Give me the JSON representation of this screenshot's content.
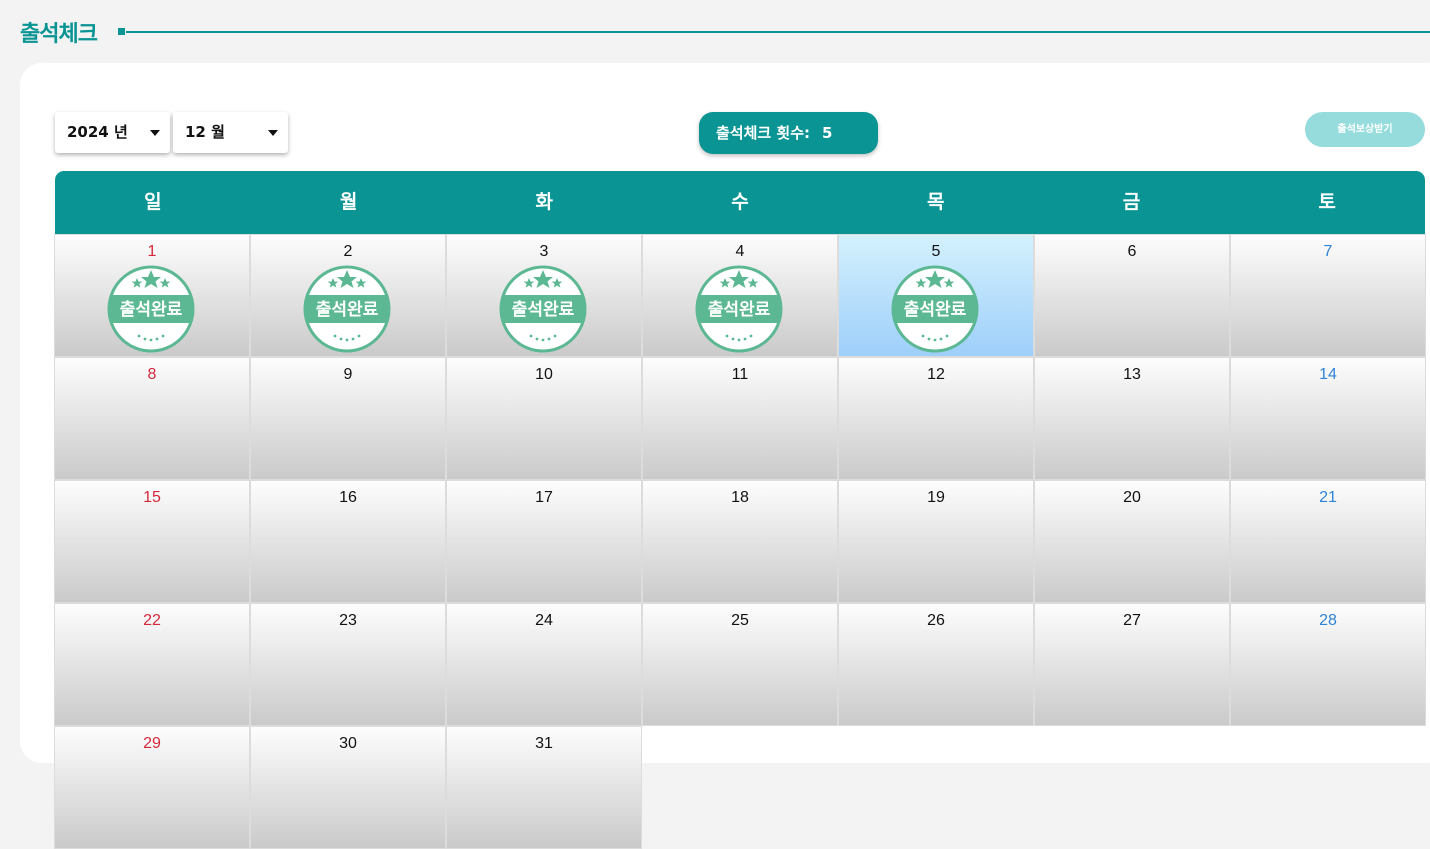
{
  "header": {
    "title": "출석체크"
  },
  "controls": {
    "year_label": "2024 년",
    "month_label": "12 월",
    "count_label": "출석체크 횟수:",
    "count_value": "5",
    "reward_button": "출석보상받기"
  },
  "stamp": {
    "text": "출석완료",
    "color": "#5cb893",
    "inner_band": "#5cb893"
  },
  "colors": {
    "accent": "#0a9494",
    "reward_button": "#96dcdc",
    "sunday": "#d4293a",
    "saturday": "#2e84d6",
    "today_highlight": "#9ecffa"
  },
  "weekdays": [
    "일",
    "월",
    "화",
    "수",
    "목",
    "금",
    "토"
  ],
  "calendar": {
    "today": 5,
    "attended_days": [
      1,
      2,
      3,
      4,
      5
    ],
    "weeks": [
      [
        "1",
        "2",
        "3",
        "4",
        "5",
        "6",
        "7"
      ],
      [
        "8",
        "9",
        "10",
        "11",
        "12",
        "13",
        "14"
      ],
      [
        "15",
        "16",
        "17",
        "18",
        "19",
        "20",
        "21"
      ],
      [
        "22",
        "23",
        "24",
        "25",
        "26",
        "27",
        "28"
      ],
      [
        "29",
        "30",
        "31",
        "",
        "",
        "",
        ""
      ]
    ]
  }
}
